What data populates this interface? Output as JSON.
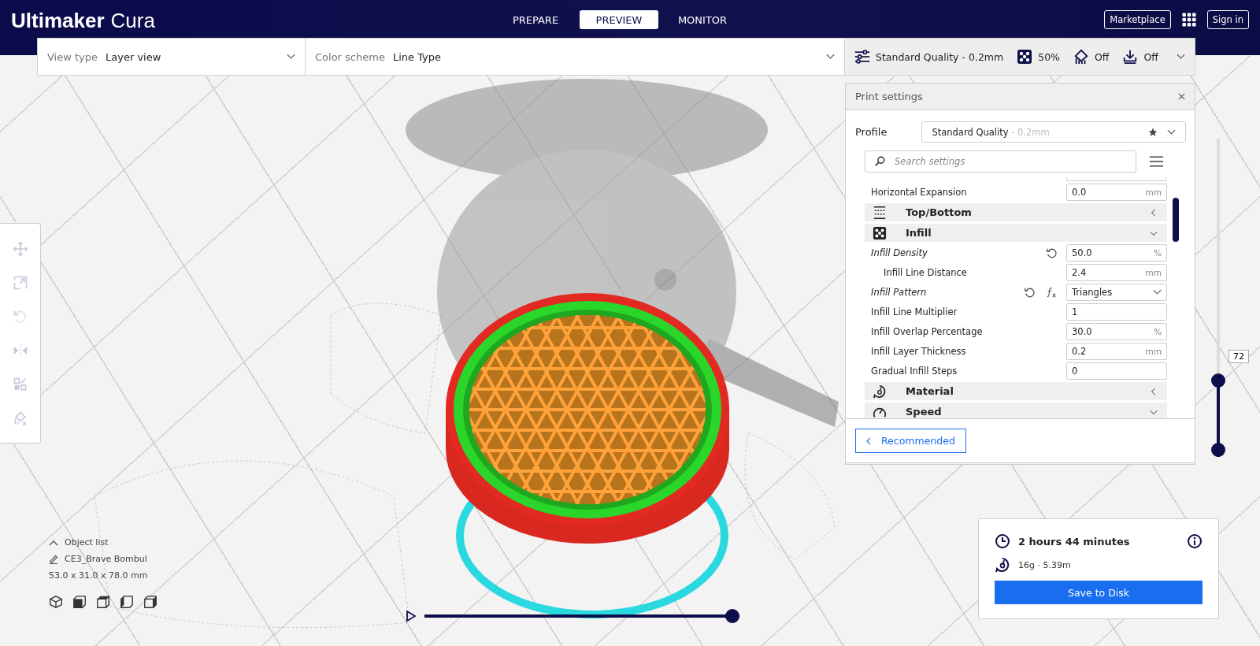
{
  "header": {
    "logo_bold": "Ultimaker",
    "logo_light": "Cura",
    "stages": [
      {
        "label": "PREPARE",
        "selected": false
      },
      {
        "label": "PREVIEW",
        "selected": true
      },
      {
        "label": "MONITOR",
        "selected": false
      }
    ],
    "marketplace": "Marketplace",
    "sign_in": "Sign in"
  },
  "view_bar": {
    "view_type_label": "View type",
    "view_type": "Layer view",
    "color_scheme_label": "Color scheme",
    "color_scheme": "Line Type",
    "quality": "Standard Quality - 0.2mm",
    "infill": "50%",
    "support": "Off",
    "adhesion": "Off"
  },
  "print_settings": {
    "title": "Print settings",
    "profile_label": "Profile",
    "profile_name": "Standard Quality",
    "profile_detail": " - 0.2mm",
    "search_placeholder": "Search settings",
    "rows": [
      {
        "kind": "setting",
        "label": "Horizontal Expansion",
        "value": "0.0",
        "unit": "mm",
        "modified": false
      },
      {
        "kind": "category",
        "label": "Top/Bottom",
        "expanded": false
      },
      {
        "kind": "category",
        "label": "Infill",
        "expanded": true
      },
      {
        "kind": "setting",
        "label": "Infill Density",
        "value": "50.0",
        "unit": "%",
        "modified": true,
        "reset": true,
        "children": [
          {
            "kind": "setting",
            "label": "Infill Line Distance",
            "value": "2.4",
            "unit": "mm",
            "modified": false
          }
        ]
      },
      {
        "kind": "dropdown",
        "label": "Infill Pattern",
        "value": "Triangles",
        "modified": true,
        "reset": true,
        "formula": true
      },
      {
        "kind": "setting",
        "label": "Infill Line Multiplier",
        "value": "1",
        "modified": false
      },
      {
        "kind": "setting",
        "label": "Infill Overlap Percentage",
        "value": "30.0",
        "unit": "%",
        "modified": false
      },
      {
        "kind": "setting",
        "label": "Infill Layer Thickness",
        "value": "0.2",
        "unit": "mm",
        "modified": false
      },
      {
        "kind": "setting",
        "label": "Gradual Infill Steps",
        "value": "0",
        "modified": false
      },
      {
        "kind": "category",
        "label": "Material",
        "expanded": false
      },
      {
        "kind": "category",
        "label": "Speed",
        "expanded": true
      }
    ],
    "recommended": "Recommended"
  },
  "layer_slider": {
    "label": "72",
    "level": 0.24
  },
  "playback": {
    "level": 1.0
  },
  "object_list": {
    "title": "Object list",
    "name": "CE3_Brave Bombul",
    "dimensions": "53.0 x 31.0 x 78.0 mm"
  },
  "print_info": {
    "time": "2 hours 44 minutes",
    "material": "16g · 5.39m",
    "save": "Save to Disk"
  }
}
